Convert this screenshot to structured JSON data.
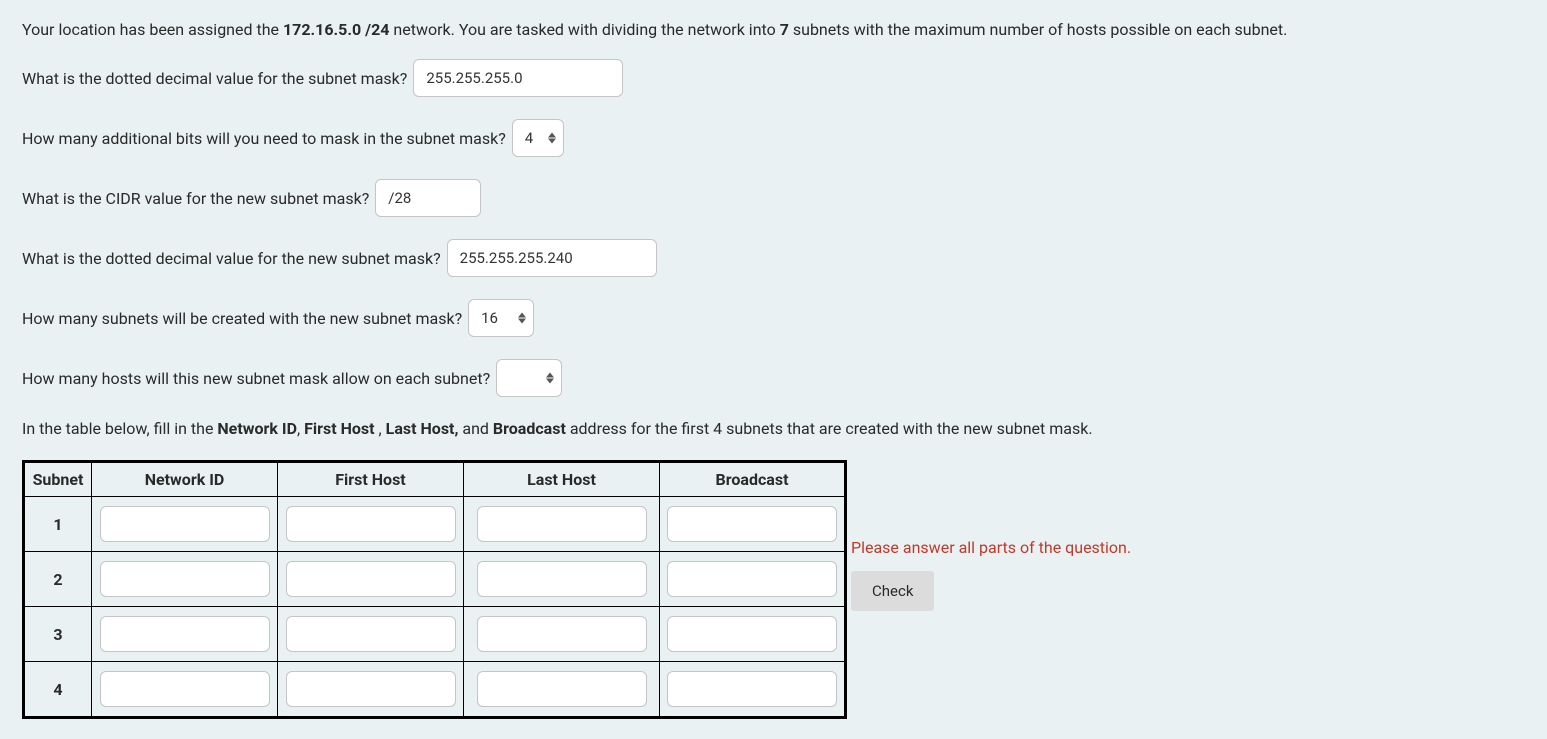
{
  "intro": {
    "prefix": "Your location has been assigned the ",
    "network": "172.16.5.0 /24",
    "middle": " network.  You are tasked with dividing the network into ",
    "subnet_count": "7",
    "suffix": " subnets with the maximum number of hosts possible on each subnet."
  },
  "questions": {
    "q1": {
      "label": "What is the dotted decimal value for the subnet mask?",
      "value": "255.255.255.0"
    },
    "q2": {
      "label": "How many additional bits will you need to mask in the subnet mask?",
      "value": "4"
    },
    "q3": {
      "label": "What is the CIDR value for the new subnet mask?",
      "value": "/28"
    },
    "q4": {
      "label": "What is the dotted decimal value for the new subnet mask?",
      "value": "255.255.255.240"
    },
    "q5": {
      "label": "How many subnets will be created with the new subnet mask?",
      "value": "16"
    },
    "q6": {
      "label": "How many hosts will this new subnet mask allow on each subnet?",
      "value": ""
    }
  },
  "table_intro": {
    "prefix": "In the table below, fill in the ",
    "f1": "Network ID",
    "sep1": ", ",
    "f2": "First Host",
    "sep2": " , ",
    "f3": "Last Host,",
    "sep3": " and ",
    "f4": "Broadcast",
    "suffix": " address for the first 4 subnets that are created with the new subnet mask."
  },
  "table": {
    "headers": {
      "subnet": "Subnet",
      "network_id": "Network ID",
      "first_host": "First Host",
      "last_host": "Last Host",
      "broadcast": "Broadcast"
    },
    "rows": [
      {
        "num": "1",
        "network_id": "",
        "first_host": "",
        "last_host": "",
        "broadcast": ""
      },
      {
        "num": "2",
        "network_id": "",
        "first_host": "",
        "last_host": "",
        "broadcast": ""
      },
      {
        "num": "3",
        "network_id": "",
        "first_host": "",
        "last_host": "",
        "broadcast": ""
      },
      {
        "num": "4",
        "network_id": "",
        "first_host": "",
        "last_host": "",
        "broadcast": ""
      }
    ]
  },
  "error_message": "Please answer all parts of the question.",
  "check_button": "Check"
}
